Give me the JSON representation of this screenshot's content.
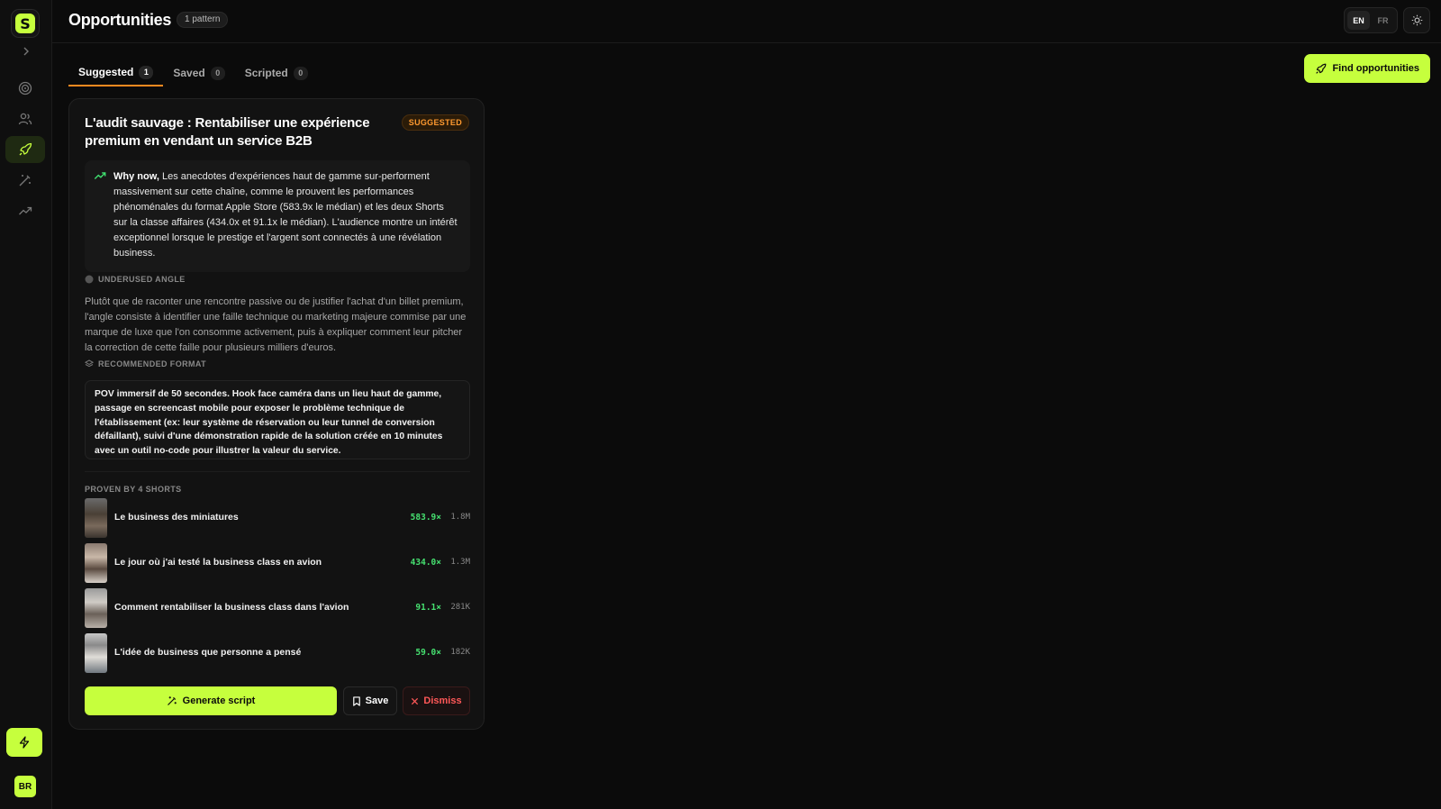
{
  "sidebar": {
    "logo_letter": "S",
    "avatar_initials": "BR"
  },
  "header": {
    "title": "Opportunities",
    "pattern_badge": "1 pattern",
    "lang_en": "EN",
    "lang_fr": "FR"
  },
  "tabs": [
    {
      "label": "Suggested",
      "count": "1"
    },
    {
      "label": "Saved",
      "count": "0"
    },
    {
      "label": "Scripted",
      "count": "0"
    }
  ],
  "find_button": "Find opportunities",
  "card": {
    "title": "L'audit sauvage : Rentabiliser une expérience premium en vendant un service B2B",
    "badge": "SUGGESTED",
    "why_now_label": "Why now,",
    "why_now_text": " Les anecdotes d'expériences haut de gamme sur-performent massivement sur cette chaîne, comme le prouvent les performances phénoménales du format Apple Store (583.9x le médian) et les deux Shorts sur la classe affaires (434.0x et 91.1x le médian). L'audience montre un intérêt exceptionnel lorsque le prestige et l'argent sont connectés à une révélation business.",
    "underused_label": "UNDERUSED ANGLE",
    "underused_text": "Plutôt que de raconter une rencontre passive ou de justifier l'achat d'un billet premium, l'angle consiste à identifier une faille technique ou marketing majeure commise par une marque de luxe que l'on consomme activement, puis à expliquer comment leur pitcher la correction de cette faille pour plusieurs milliers d'euros.",
    "format_label": "RECOMMENDED FORMAT",
    "format_text": "POV immersif de 50 secondes. Hook face caméra dans un lieu haut de gamme, passage en screencast mobile pour exposer le problème technique de l'établissement (ex: leur système de réservation ou leur tunnel de conversion défaillant), suivi d'une démonstration rapide de la solution créée en 10 minutes avec un outil no-code pour illustrer la valeur du service.",
    "proven_label": "PROVEN BY 4 SHORTS",
    "shorts": [
      {
        "title": "Le business des miniatures",
        "multiplier": "583.9×",
        "views": "1.8M"
      },
      {
        "title": "Le jour où j'ai testé la business class en avion",
        "multiplier": "434.0×",
        "views": "1.3M"
      },
      {
        "title": "Comment rentabiliser la business class dans l'avion",
        "multiplier": "91.1×",
        "views": "281K"
      },
      {
        "title": "L'idée de business que personne a pensé",
        "multiplier": "59.0×",
        "views": "182K"
      }
    ],
    "generate_button": "Generate script",
    "save_button": "Save",
    "dismiss_button": "Dismiss"
  },
  "colors": {
    "accent": "#c6ff3d",
    "badge_orange": "#ff9a30",
    "positive_green": "#46e070",
    "danger_red": "#ff5858",
    "background": "#0b0b0b"
  }
}
